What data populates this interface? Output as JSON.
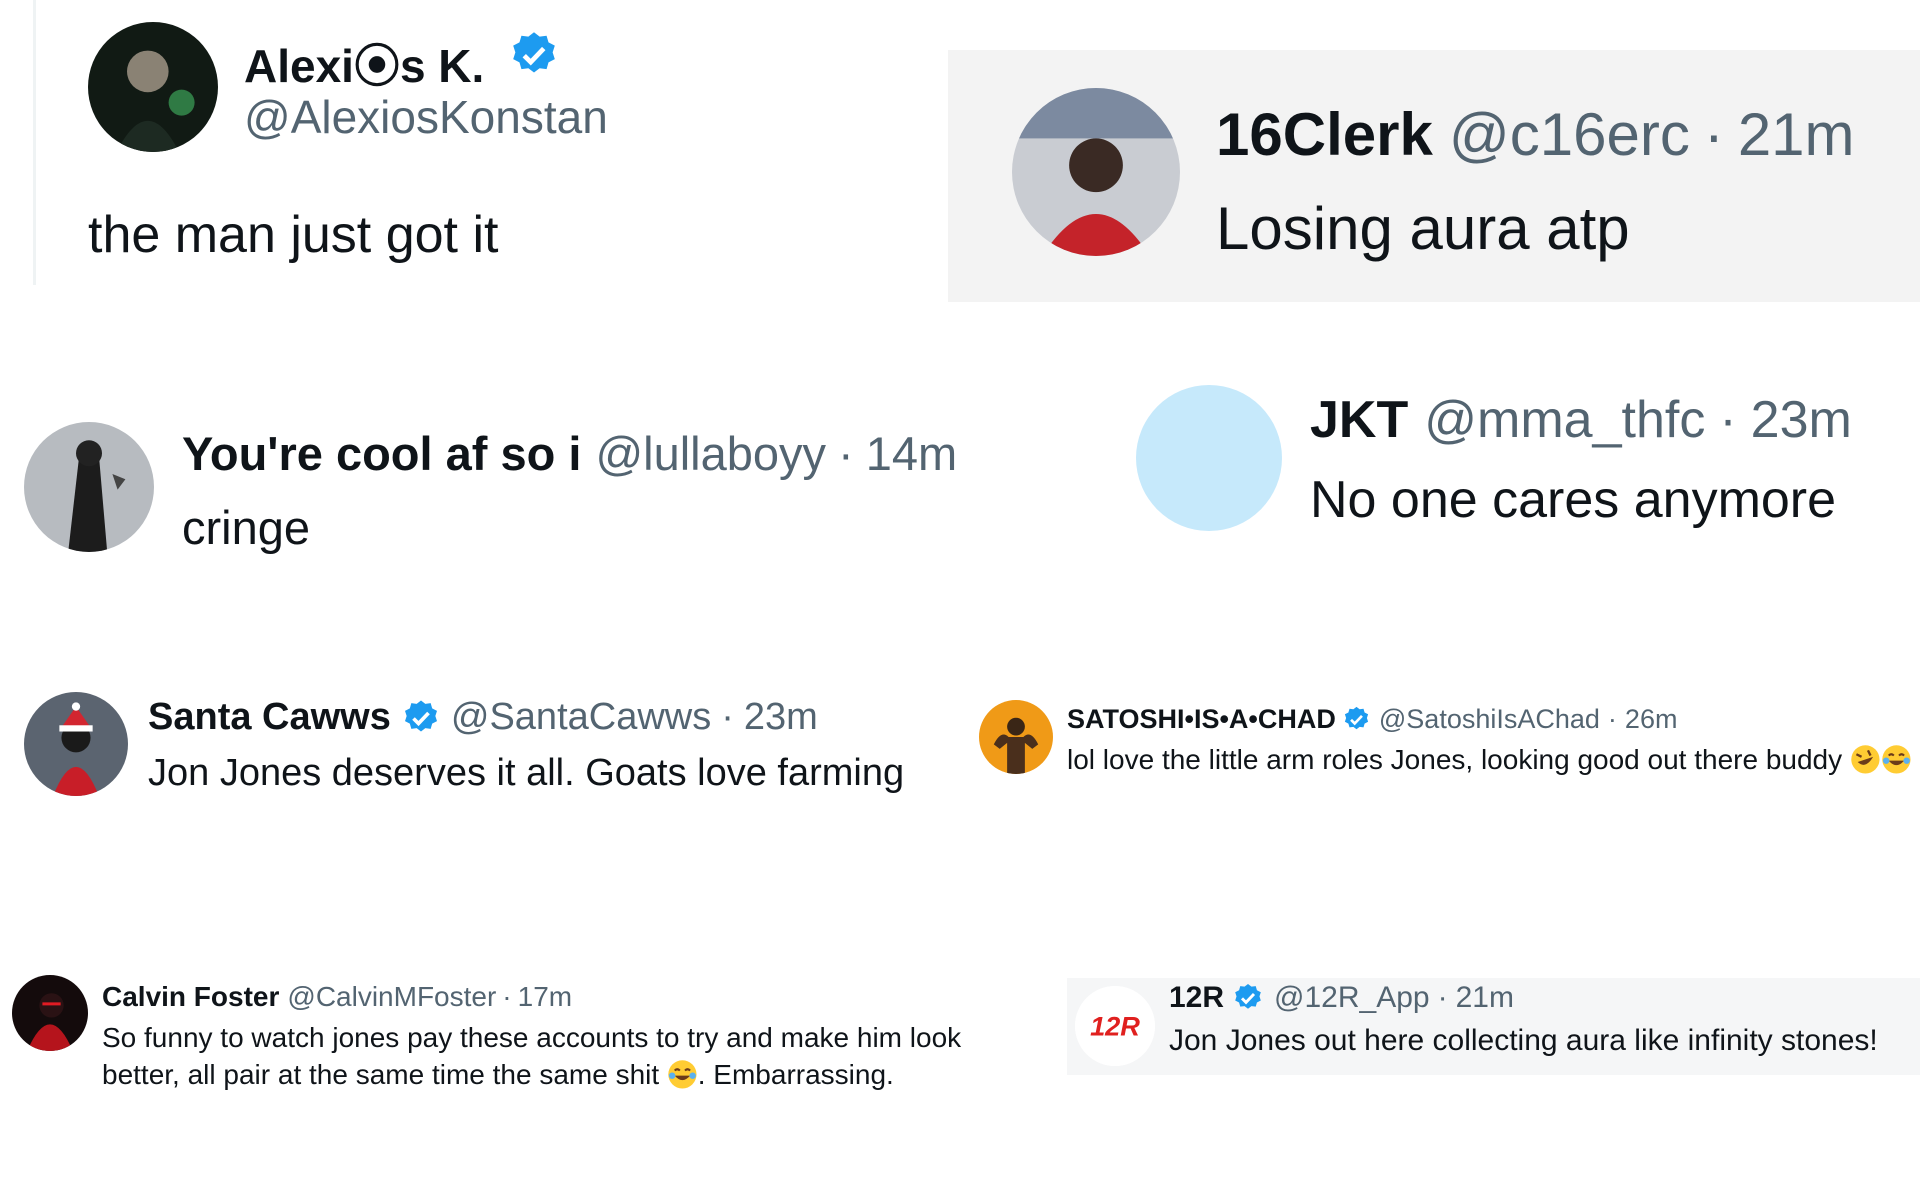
{
  "colors": {
    "verified": "#1d9bf0",
    "text": "#0f1419",
    "muted": "#536471"
  },
  "tweets": [
    {
      "name": "Alexi⦿s K.",
      "handle": "@AlexiosKonstan",
      "verified": true,
      "text": "the man just got it"
    },
    {
      "name": "16Clerk",
      "handle": "@c16erc",
      "time": "21m",
      "text": "Losing aura atp"
    },
    {
      "name": "You're cool af so i",
      "handle": "@lullaboyy",
      "time": "14m",
      "text": "cringe"
    },
    {
      "name": "JKT",
      "handle": "@mma_thfc",
      "time": "23m",
      "text": "No one cares anymore"
    },
    {
      "name": "Santa Cawws",
      "handle": "@SantaCawws",
      "time": "23m",
      "verified": true,
      "text": "Jon Jones deserves it all. Goats love farming"
    },
    {
      "name": "SATOSHI•IS•A•CHAD",
      "handle": "@SatoshiIsAChad",
      "time": "26m",
      "verified": true,
      "text": "lol love the little arm roles Jones, looking good out there buddy"
    },
    {
      "name": "Calvin Foster",
      "handle": "@CalvinMFoster",
      "time": "17m",
      "text_part1": "So funny to watch jones pay these accounts to try and make him look better, all pair at the same time the same shit",
      "text_part2": ". Embarrassing."
    },
    {
      "name": "12R",
      "handle": "@12R_App",
      "time": "21m",
      "verified": true,
      "text": "Jon Jones out here collecting aura like infinity stones!",
      "logo_text": "12R"
    }
  ],
  "separator": "·",
  "icons": {
    "verified": "verified-badge-icon",
    "emoji_rofl": "rofl-emoji-icon",
    "emoji_joy": "tears-of-joy-emoji-icon"
  }
}
